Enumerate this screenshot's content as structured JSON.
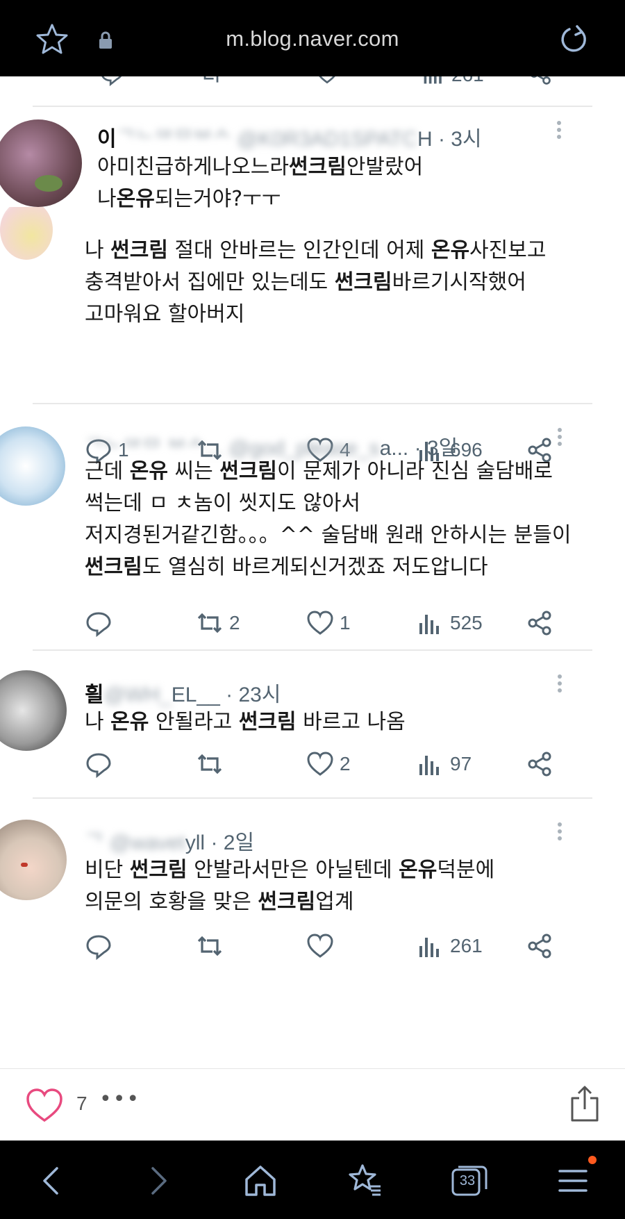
{
  "browser": {
    "url": "m.blog.naver.com",
    "tab_count": "33"
  },
  "partial_prev_actions": {
    "views": "261"
  },
  "posts": [
    {
      "handle_prefix": "이",
      "handle_blurred": "ᄀᄂᄃᄅᄆᄇᄉ @K0R3AD1SPATC",
      "handle_suffix": "H",
      "time": "· 3시",
      "lines": [
        [
          {
            "t": "아미친급하게나오느라"
          },
          {
            "t": "썬크림",
            "b": true
          },
          {
            "t": "안발랐어"
          }
        ],
        [
          {
            "t": "나"
          },
          {
            "t": "온유",
            "b": true
          },
          {
            "t": "되는거야?ㅜㅜ"
          }
        ]
      ],
      "avatar_color": "#7a5a6a"
    },
    {
      "lines": [
        [
          {
            "t": "나 "
          },
          {
            "t": "썬크림",
            "b": true
          },
          {
            "t": " 절대 안바르는 인간인데 어제 "
          },
          {
            "t": "온유",
            "b": true
          },
          {
            "t": "사진보고"
          }
        ],
        [
          {
            "t": "충격받아서 집에만 있는데도 "
          },
          {
            "t": "썬크림",
            "b": true
          },
          {
            "t": "바르기시작했어"
          }
        ],
        [
          {
            "t": "고마워요 할아버지"
          }
        ]
      ],
      "reply": "1",
      "repost": "",
      "like": "4",
      "views": "696"
    },
    {
      "handle_blurred": "ᄀᄂᄃᄅᄆ ᄇᄉ... @god_please_s",
      "handle_suffix": "a...",
      "time": "· 3일",
      "lines": [
        [
          {
            "t": "근데 "
          },
          {
            "t": "온유",
            "b": true
          },
          {
            "t": " 씨는 "
          },
          {
            "t": "썬크림",
            "b": true
          },
          {
            "t": "이 문제가 아니라 진심 술담배로"
          }
        ],
        [
          {
            "t": "썩는데 ㅁ ㅊ놈이 씻지도 않아서"
          }
        ],
        [
          {
            "t": "저지경된거같긴함。。。^^ 술담배 원래 안하시는 분들이"
          }
        ],
        [
          {
            "t": "썬크림",
            "b": true
          },
          {
            "t": "도 열심히 바르게되신거겠죠 저도압니다"
          }
        ]
      ],
      "reply": "",
      "repost": "2",
      "like": "1",
      "views": "525"
    },
    {
      "handle_prefix": "흴",
      "handle_blurred": " @WH_",
      "handle_suffix": "EL__",
      "time": "· 23시",
      "lines": [
        [
          {
            "t": "나 "
          },
          {
            "t": "온유",
            "b": true
          },
          {
            "t": " 안될라고 "
          },
          {
            "t": "썬크림",
            "b": true
          },
          {
            "t": " 바르고 나옴"
          }
        ]
      ],
      "reply": "",
      "repost": "",
      "like": "2",
      "views": "97"
    },
    {
      "handle_blurred": "ᄀ @wavet",
      "handle_suffix": "yll",
      "time": "· 2일",
      "lines": [
        [
          {
            "t": "비단 "
          },
          {
            "t": "썬크림",
            "b": true
          },
          {
            "t": " 안발라서만은 아닐텐데 "
          },
          {
            "t": "온유",
            "b": true
          },
          {
            "t": "덕분에"
          }
        ],
        [
          {
            "t": "의문의 호황을 맞은 "
          },
          {
            "t": "썬크림",
            "b": true
          },
          {
            "t": "업계"
          }
        ]
      ],
      "reply": "",
      "repost": "",
      "like": "",
      "views": "261"
    }
  ],
  "likebar": {
    "count": "7",
    "more": "•••"
  },
  "colors": {
    "heart_pink": "#e84a7f",
    "icon_gray": "#536471",
    "nav_icon": "#9fb8d8",
    "notification_dot": "#ff5a1f"
  },
  "icons": [
    "star-icon",
    "lock-icon",
    "reload-icon",
    "reply-icon",
    "repost-icon",
    "like-icon",
    "views-icon",
    "share-icon",
    "heart-icon",
    "upload-icon",
    "back-icon",
    "forward-icon",
    "home-icon",
    "bookmarks-icon",
    "tabs-icon",
    "menu-icon"
  ]
}
